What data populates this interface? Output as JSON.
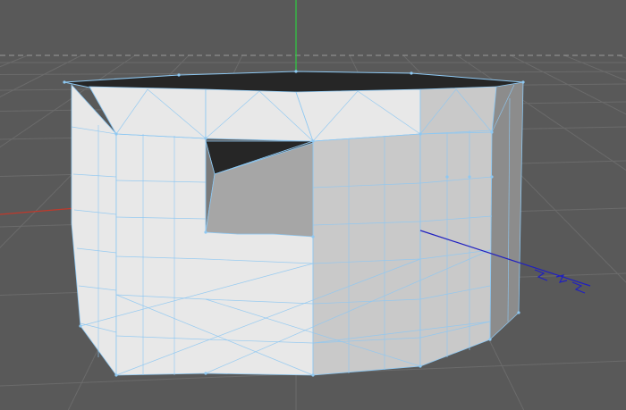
{
  "viewport": {
    "background": "#595959",
    "grid_color": "#6b6b6b",
    "horizon_color": "#9a9a9a",
    "axis_x_color": "#c0392b",
    "axis_y_color": "#2ecc40",
    "axis_z_color": "#2020c0",
    "wire_color": "#8ec8f2",
    "edge_dark_color": "#1a1a1a"
  },
  "object": {
    "type": "polygon-mesh",
    "icon": "mesh-icon",
    "selected_face_fill": "#f2f2f2",
    "shade_light": "#e8e8e8",
    "shade_mid": "#c9c9c9",
    "shade_dark": "#8c8c8c",
    "shade_black": "#262626"
  }
}
